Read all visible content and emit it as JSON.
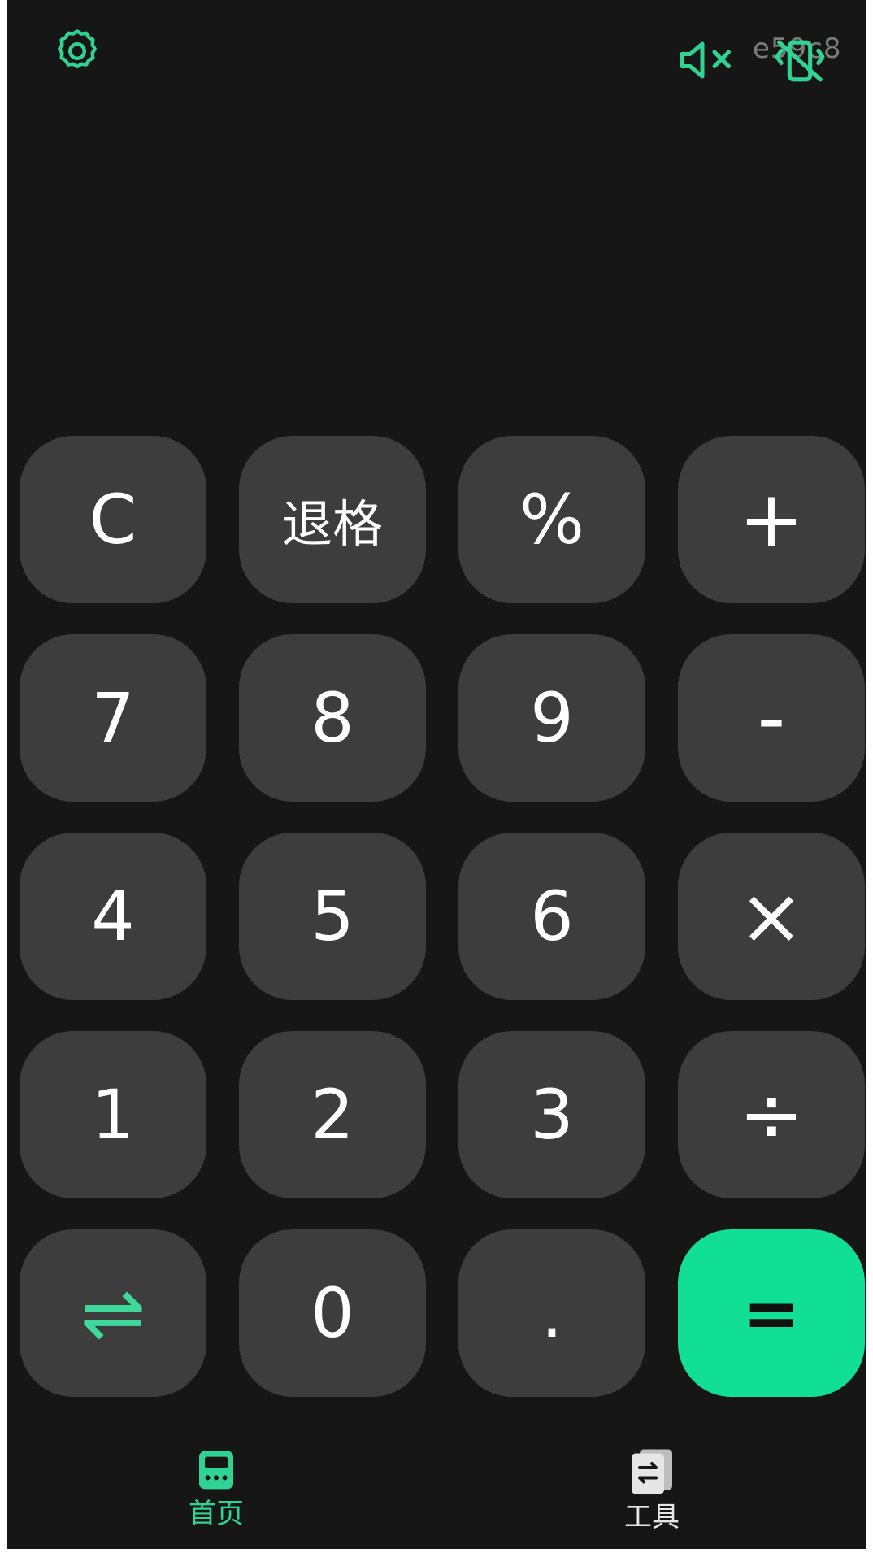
{
  "topbar": {
    "settings_icon": "gear-icon",
    "mute_icon": "speaker-mute-icon",
    "vibrate_icon": "vibrate-off-icon",
    "watermark": "e59c8",
    "accent_color": "#2fd495"
  },
  "keypad": {
    "row1": [
      "C",
      "退格",
      "%",
      "+"
    ],
    "row2": [
      "7",
      "8",
      "9",
      "-"
    ],
    "row3": [
      "4",
      "5",
      "6",
      "×"
    ],
    "row4": [
      "1",
      "2",
      "3",
      "÷"
    ],
    "row5": [
      "⇌",
      "0",
      ".",
      "="
    ],
    "equals_color": "#12df96",
    "key_color": "#3d3d3d"
  },
  "tabs": {
    "home_label": "首页",
    "tools_label": "工具",
    "home_icon": "calculator-icon",
    "tools_icon": "convert-cards-icon"
  }
}
